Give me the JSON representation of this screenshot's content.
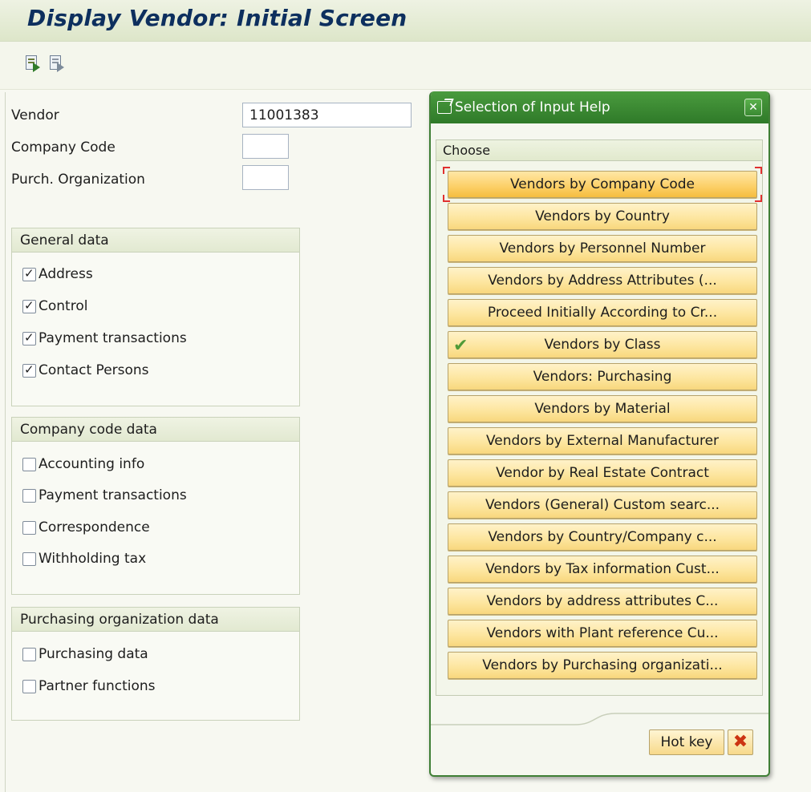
{
  "window": {
    "title": "Display Vendor: Initial Screen"
  },
  "toolbar": {
    "icons": [
      "execute-left-icon",
      "execute-right-icon"
    ]
  },
  "form": {
    "vendor_label": "Vendor",
    "vendor_value": "11001383",
    "company_code_label": "Company Code",
    "company_code_value": "",
    "purch_org_label": "Purch. Organization",
    "purch_org_value": ""
  },
  "general_data": {
    "title": "General data",
    "items": [
      {
        "label": "Address",
        "checked": true
      },
      {
        "label": "Control",
        "checked": true
      },
      {
        "label": "Payment transactions",
        "checked": true
      },
      {
        "label": "Contact Persons",
        "checked": true
      }
    ]
  },
  "company_code_data": {
    "title": "Company code data",
    "items": [
      {
        "label": "Accounting info",
        "checked": false
      },
      {
        "label": "Payment transactions",
        "checked": false
      },
      {
        "label": "Correspondence",
        "checked": false
      },
      {
        "label": "Withholding tax",
        "checked": false
      }
    ]
  },
  "purchasing_org_data": {
    "title": "Purchasing organization data",
    "items": [
      {
        "label": "Purchasing data",
        "checked": false
      },
      {
        "label": "Partner functions",
        "checked": false
      }
    ]
  },
  "dialog": {
    "title": "Selection of Input Help",
    "close_glyph": "✕",
    "choose_label": "Choose",
    "options": [
      {
        "label": "Vendors by Company Code",
        "focused": true,
        "checked": false
      },
      {
        "label": "Vendors by Country",
        "focused": false,
        "checked": false
      },
      {
        "label": "Vendors by Personnel Number",
        "focused": false,
        "checked": false
      },
      {
        "label": "Vendors by Address Attributes (...",
        "focused": false,
        "checked": false
      },
      {
        "label": "Proceed Initially According to Cr...",
        "focused": false,
        "checked": false
      },
      {
        "label": "Vendors by Class",
        "focused": false,
        "checked": true
      },
      {
        "label": "Vendors: Purchasing",
        "focused": false,
        "checked": false
      },
      {
        "label": "Vendors by Material",
        "focused": false,
        "checked": false
      },
      {
        "label": "Vendors by External Manufacturer",
        "focused": false,
        "checked": false
      },
      {
        "label": "Vendor by Real Estate Contract",
        "focused": false,
        "checked": false
      },
      {
        "label": "Vendors (General) Custom searc...",
        "focused": false,
        "checked": false
      },
      {
        "label": "Vendors by Country/Company c...",
        "focused": false,
        "checked": false
      },
      {
        "label": "Vendors by Tax information Cust...",
        "focused": false,
        "checked": false
      },
      {
        "label": "Vendors by address attributes C...",
        "focused": false,
        "checked": false
      },
      {
        "label": "Vendors with Plant reference Cu...",
        "focused": false,
        "checked": false
      },
      {
        "label": "Vendors by Purchasing organizati...",
        "focused": false,
        "checked": false
      }
    ],
    "hotkey_label": "Hot key",
    "cancel_glyph": "✖",
    "check_glyph": "✔"
  }
}
